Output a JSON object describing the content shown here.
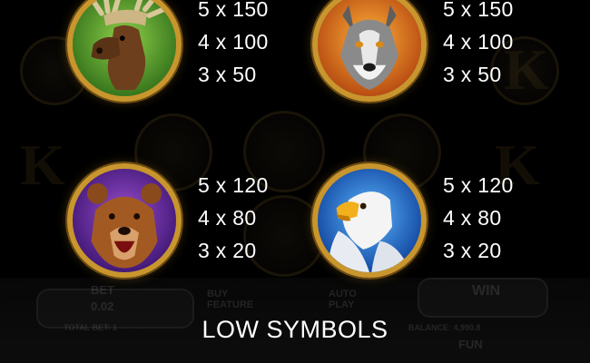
{
  "symbols": [
    {
      "name": "moose",
      "icon": "moose-icon",
      "pays": [
        "5 x 150",
        "4 x 100",
        "3 x 50"
      ]
    },
    {
      "name": "wolf",
      "icon": "wolf-icon",
      "pays": [
        "5 x 150",
        "4 x 100",
        "3 x 50"
      ]
    },
    {
      "name": "bear",
      "icon": "bear-icon",
      "pays": [
        "5 x 120",
        "4 x 80",
        "3 x 20"
      ]
    },
    {
      "name": "eagle",
      "icon": "eagle-icon",
      "pays": [
        "5 x 120",
        "4 x 80",
        "3 x 20"
      ]
    }
  ],
  "section_title": "LOW SYMBOLS",
  "background_hud": {
    "bet_label": "BET",
    "bet_value": "0.02",
    "total_bet": "TOTAL BET: 1",
    "buy_feature": "BUY FEATURE",
    "auto_play": "AUTO PLAY",
    "win_label": "WIN",
    "balance": "BALANCE: 4,990.8",
    "currency": "FUN"
  },
  "colors": {
    "medallion_gold": "#c9962e",
    "background": "#000000",
    "text": "#ffffff"
  }
}
